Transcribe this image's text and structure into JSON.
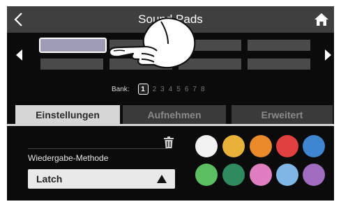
{
  "header": {
    "title": "Sound Pads",
    "back_icon": "chevron-left-icon",
    "home_icon": "home-icon"
  },
  "bank": {
    "label": "Bank:",
    "numbers": [
      "1",
      "2",
      "3",
      "4",
      "5",
      "6",
      "7",
      "8"
    ],
    "active": "1"
  },
  "tabs": [
    {
      "label": "Einstellungen",
      "active": true
    },
    {
      "label": "Aufnehmen",
      "active": false
    },
    {
      "label": "Erweitert",
      "active": false
    }
  ],
  "settings": {
    "method_label": "Wiedergabe-Methode",
    "method_value": "Latch"
  },
  "colors": [
    "#f2f2f2",
    "#e8b23a",
    "#e88a2a",
    "#e04040",
    "#3f86d0",
    "#5bbf62",
    "#2f8a60",
    "#e07fbf",
    "#7fb6e6",
    "#a06cc0"
  ],
  "accent": {
    "selected_pad": "#9c9cb4",
    "tab_active": "#d6d6d6",
    "topbar": "#3f3f3f"
  }
}
